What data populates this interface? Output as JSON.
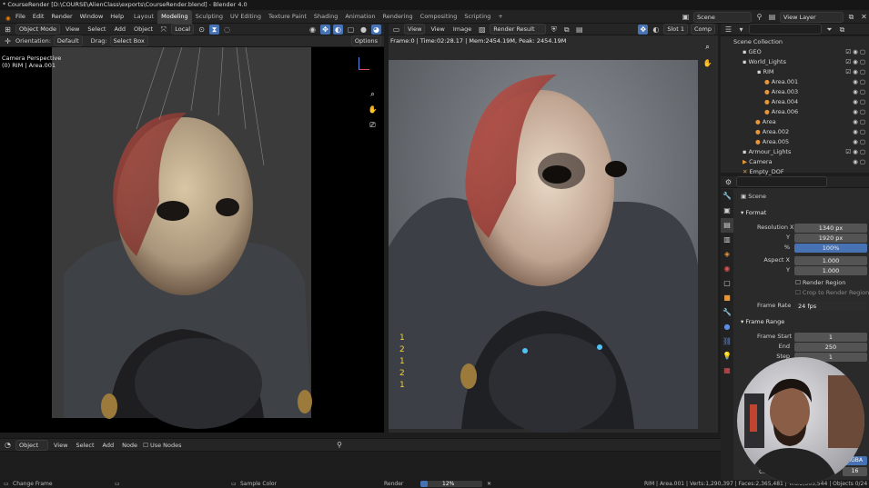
{
  "window": {
    "title": "* CourseRender [D:\\COURSE\\AlienClass\\exports\\CourseRender.blend] - Blender 4.0"
  },
  "menu": [
    "File",
    "Edit",
    "Render",
    "Window",
    "Help"
  ],
  "workspaces": [
    "Layout",
    "Modeling",
    "Sculpting",
    "UV Editing",
    "Texture Paint",
    "Shading",
    "Animation",
    "Rendering",
    "Compositing",
    "Scripting"
  ],
  "active_workspace": "Modeling",
  "top_right": {
    "scene": "Scene",
    "view_layer": "View Layer"
  },
  "viewport": {
    "mode": "Object Mode",
    "menus": [
      "View",
      "Select",
      "Add",
      "Object"
    ],
    "transform": "Local",
    "orientation_label": "Orientation:",
    "orientation_value": "Default",
    "drag_label": "Drag:",
    "drag_value": "Select Box",
    "options": "Options",
    "overlay_line1": "Camera Perspective",
    "overlay_line2": "(0) RIM | Area.001"
  },
  "render_view": {
    "menus": [
      "View",
      "View",
      "Image"
    ],
    "image": "Render Result",
    "slot": "Slot 1",
    "comp": "Comp",
    "stats": "Frame:0 | Time:02:28.17 | Mem:2454.19M, Peak: 2454.19M",
    "overlay_digits": [
      "1",
      "2",
      "1",
      "2",
      "1"
    ]
  },
  "outliner": {
    "rows": [
      {
        "label": "Scene Collection",
        "indent": 0
      },
      {
        "label": "GEO",
        "indent": 1
      },
      {
        "label": "World_Lights",
        "indent": 1
      },
      {
        "label": "RIM",
        "indent": 2
      },
      {
        "label": "Area.001",
        "indent": 3
      },
      {
        "label": "Area.003",
        "indent": 3
      },
      {
        "label": "Area.004",
        "indent": 3
      },
      {
        "label": "Area.006",
        "indent": 3
      },
      {
        "label": "Area",
        "indent": 2
      },
      {
        "label": "Area.002",
        "indent": 2
      },
      {
        "label": "Area.005",
        "indent": 2
      },
      {
        "label": "Armour_Lights",
        "indent": 1
      },
      {
        "label": "Camera",
        "indent": 1
      },
      {
        "label": "Empty_DOF",
        "indent": 1
      }
    ]
  },
  "properties": {
    "context": "Scene",
    "format_panel": "Format",
    "res_x_label": "Resolution X",
    "res_x": "1340 px",
    "res_y_label": "Y",
    "res_y": "1920 px",
    "res_pct_label": "%",
    "res_pct": "100%",
    "aspect_x_label": "Aspect X",
    "aspect_x": "1.000",
    "aspect_y_label": "Y",
    "aspect_y": "1.000",
    "render_region": "Render Region",
    "crop_region": "Crop to Render Region",
    "frame_rate_label": "Frame Rate",
    "frame_rate": "24 fps",
    "frame_range_panel": "Frame Range",
    "frame_start_label": "Frame Start",
    "frame_start": "1",
    "end_label": "End",
    "end": "250",
    "step_label": "Step",
    "step": "1",
    "color_mgmt_partial": "Co",
    "rgba_partial": "RGBA",
    "depth_partial": "16"
  },
  "node_editor": {
    "type": "Object",
    "menus": [
      "View",
      "Select",
      "Add",
      "Node"
    ],
    "use_nodes": "Use Nodes"
  },
  "status": {
    "left": "Change Frame",
    "sample": "Sample Color",
    "render_label": "Render",
    "render_progress": "12%",
    "render_fraction": 0.12,
    "right": "RIM | Area.001 | Verts:1,290,397 | Faces:2,365,481 | Tris:2,505,544 | Objects 0/24"
  },
  "colors": {
    "accent": "#4772b3",
    "outliner_orange": "#e8963a",
    "collection_white": "#dcdcdc"
  }
}
